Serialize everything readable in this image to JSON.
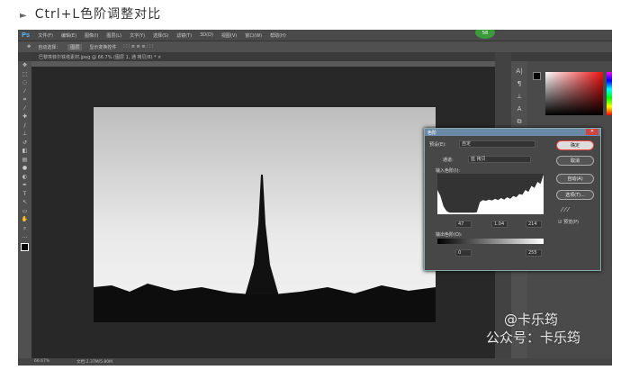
{
  "heading": {
    "marker": "►",
    "text": "Ctrl+L色阶调整对比"
  },
  "ps": {
    "logo": "Ps",
    "menu": [
      "文件(F)",
      "编辑(E)",
      "图像(I)",
      "图层(L)",
      "文字(Y)",
      "选择(S)",
      "滤镜(T)",
      "3D(D)",
      "视图(V)",
      "窗口(W)",
      "帮助(H)"
    ],
    "options": {
      "auto_select": "自动选择：",
      "layer": "图层",
      "show_transform": "显示变换控件"
    },
    "tab": "巴黎埃菲尔铁塔素材.jpeg @ 66.7% (图层 1, 通 拷贝/8) * ×",
    "status": {
      "zoom": "66.67%",
      "doc": "文档:2.37M/5.80M"
    },
    "badge": "58"
  },
  "levels": {
    "title": "色阶",
    "preset_label": "预设(E):",
    "preset_value": "自定",
    "channel_label": "通道:",
    "channel_value": "蓝 拷贝",
    "input_label": "输入色阶(I):",
    "input_values": [
      "47",
      "1.04",
      "214"
    ],
    "output_label": "输出色阶(O):",
    "output_values": [
      "0",
      "255"
    ],
    "buttons": {
      "ok": "确定",
      "cancel": "取消",
      "auto": "自动(A)",
      "options": "选项(T)..."
    },
    "preview": "预览(P)",
    "histogram": [
      60,
      45,
      20,
      8,
      4,
      4,
      4,
      4,
      4,
      4,
      4,
      4,
      4,
      5,
      30,
      35,
      33,
      36,
      34,
      38,
      35,
      40,
      36,
      42,
      38,
      45,
      42,
      50,
      48,
      60,
      55,
      70,
      65,
      80,
      75,
      98
    ]
  },
  "watermark": {
    "line1": "@卡乐筠",
    "line2": "公众号：卡乐筠"
  }
}
